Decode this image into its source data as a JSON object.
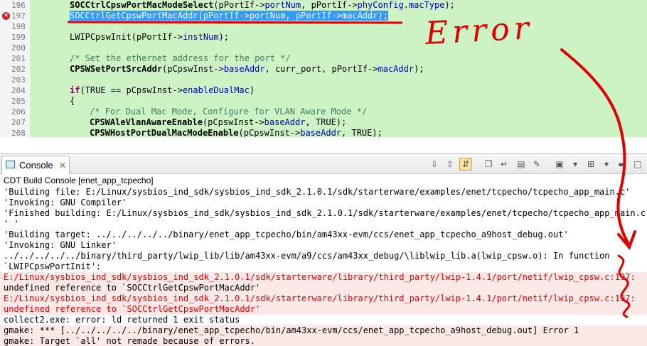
{
  "editor": {
    "lines": [
      {
        "num": "196",
        "parts": [
          {
            "c": "fn",
            "t": "SOCCtrlCpswPortMacModeSelect"
          },
          {
            "c": "",
            "t": "(pPortIf->"
          },
          {
            "c": "fld",
            "t": "portNum"
          },
          {
            "c": "",
            "t": ", pPortIf->"
          },
          {
            "c": "fld",
            "t": "phyConfig"
          },
          {
            "c": "",
            "t": "."
          },
          {
            "c": "fld",
            "t": "macType"
          },
          {
            "c": "",
            "t": ");"
          }
        ]
      },
      {
        "num": "197",
        "error": true,
        "parts": [
          {
            "c": "sel",
            "t": "SOCCtrlGetCpswPortMacAddr(pPortIf->portNum, pPortIf->macAddr);"
          }
        ]
      },
      {
        "num": "198",
        "parts": []
      },
      {
        "num": "199",
        "parts": [
          {
            "c": "",
            "t": "LWIPCpswInit(pPortIf->"
          },
          {
            "c": "fld",
            "t": "instNum"
          },
          {
            "c": "",
            "t": ");"
          }
        ]
      },
      {
        "num": "200",
        "parts": []
      },
      {
        "num": "201",
        "parts": [
          {
            "c": "cmt",
            "t": "/* Set the ethernet address for the port */"
          }
        ]
      },
      {
        "num": "202",
        "parts": [
          {
            "c": "fn",
            "t": "CPSWSetPortSrcAddr"
          },
          {
            "c": "",
            "t": "(pCpswInst->"
          },
          {
            "c": "fld",
            "t": "baseAddr"
          },
          {
            "c": "",
            "t": ", curr_port, pPortIf->"
          },
          {
            "c": "fld",
            "t": "macAddr"
          },
          {
            "c": "",
            "t": ");"
          }
        ]
      },
      {
        "num": "203",
        "parts": []
      },
      {
        "num": "204",
        "parts": [
          {
            "c": "kw",
            "t": "if"
          },
          {
            "c": "",
            "t": "(TRUE == pCpswInst->"
          },
          {
            "c": "fld",
            "t": "enableDualMac"
          },
          {
            "c": "",
            "t": ")"
          }
        ]
      },
      {
        "num": "205",
        "parts": [
          {
            "c": "",
            "t": "{"
          }
        ]
      },
      {
        "num": "206",
        "indent": true,
        "parts": [
          {
            "c": "cmt",
            "t": "/* For Dual Mac Mode, Configure for VLAN Aware Mode */"
          }
        ]
      },
      {
        "num": "207",
        "indent": true,
        "parts": [
          {
            "c": "fn",
            "t": "CPSWAleVlanAwareEnable"
          },
          {
            "c": "",
            "t": "(pCpswInst->"
          },
          {
            "c": "fld",
            "t": "baseAddr"
          },
          {
            "c": "",
            "t": ", TRUE);"
          }
        ]
      },
      {
        "num": "208",
        "indent": true,
        "parts": [
          {
            "c": "fn",
            "t": "CPSWHostPortDualMacModeEnable"
          },
          {
            "c": "",
            "t": "(pCpswInst->"
          },
          {
            "c": "fld",
            "t": "baseAddr"
          },
          {
            "c": "",
            "t": ", TRUE);"
          }
        ]
      }
    ]
  },
  "annotation": {
    "text": "Error",
    "color": "#e00000"
  },
  "console": {
    "tab_label": "Console",
    "title": "CDT Build Console [enet_app_tcpecho]",
    "toolbar_icons": [
      "arrow-down-icon",
      "arrow-up-icon",
      "scroll-lock-icon",
      "copy-icon",
      "word-wrap-icon",
      "clear-console-icon",
      "pin-console-icon",
      "display-console-icon",
      "dropdown-arrow-icon",
      "new-console-icon",
      "dropdown-arrow-icon",
      "minimize-icon",
      "maximize-icon"
    ],
    "output": [
      {
        "t": "'Building file: E:/Linux/sysbios_ind_sdk/sysbios_ind_sdk_2.1.0.1/sdk/starterware/examples/enet/tcpecho/tcpecho_app_main.c'",
        "s": "normal"
      },
      {
        "t": "'Invoking: GNU Compiler'",
        "s": "normal"
      },
      {
        "t": "'Finished building: E:/Linux/sysbios_ind_sdk/sysbios_ind_sdk_2.1.0.1/sdk/starterware/examples/enet/tcpecho/tcpecho_app_main.c'",
        "s": "normal"
      },
      {
        "t": "' '",
        "s": "normal"
      },
      {
        "t": "'Building target: ../../../../../binary/enet_app_tcpecho/bin/am43xx-evm/ccs/enet_app_tcpecho_a9host_debug.out'",
        "s": "normal"
      },
      {
        "t": "'Invoking: GNU Linker'",
        "s": "normal"
      },
      {
        "t": "../../../../../binary/third_party/lwip_lib/lib/am43xx-evm/a9/ccs/am43xx_debug/\\liblwip_lib.a(lwip_cpsw.o): In function",
        "s": "normal"
      },
      {
        "t": "`LWIPCpswPortInit':",
        "s": "normal"
      },
      {
        "t": "E:/Linux/sysbios_ind_sdk/sysbios_ind_sdk_2.1.0.1/sdk/starterware/library/third_party/lwip-1.4.1/port/netif/lwip_cpsw.c:197:",
        "s": "err"
      },
      {
        "t": "undefined reference to `SOCCtrlGetCpswPortMacAddr'",
        "s": "warn"
      },
      {
        "t": "E:/Linux/sysbios_ind_sdk/sysbios_ind_sdk_2.1.0.1/sdk/starterware/library/third_party/lwip-1.4.1/port/netif/lwip_cpsw.c:197:",
        "s": "err"
      },
      {
        "t": "undefined reference to `SOCCtrlGetCpswPortMacAddr'",
        "s": "err"
      },
      {
        "t": "collect2.exe: error: ld returned 1 exit status",
        "s": "normal"
      },
      {
        "t": "gmake: *** [../../../../../binary/enet_app_tcpecho/bin/am43xx-evm/ccs/enet_app_tcpecho_a9host_debug.out] Error 1",
        "s": "warn"
      },
      {
        "t": "gmake: Target `all' not remade because of errors.",
        "s": "warn"
      }
    ]
  }
}
